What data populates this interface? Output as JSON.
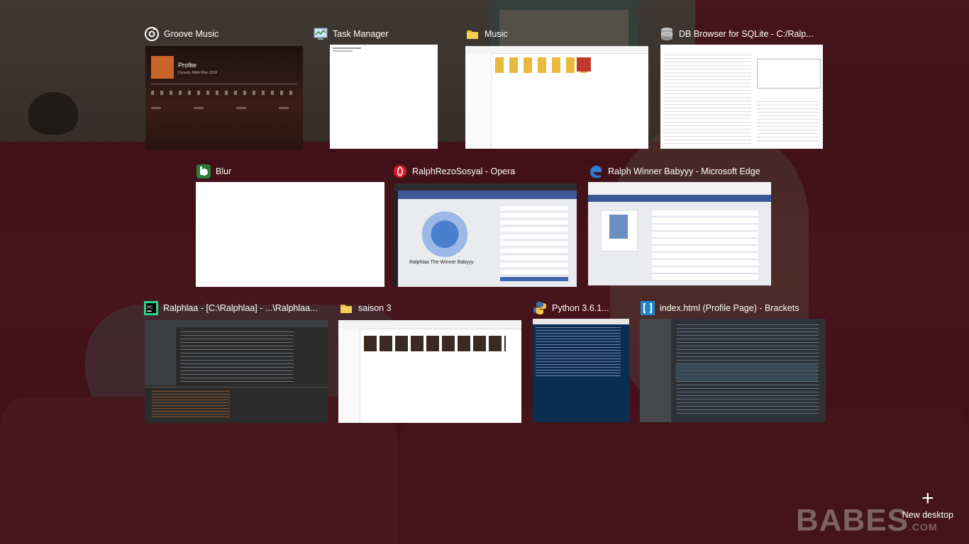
{
  "tasks": [
    {
      "title": "Groove Music",
      "icon": "groove-music-icon"
    },
    {
      "title": "Task Manager",
      "icon": "task-manager-icon"
    },
    {
      "title": "Music",
      "icon": "folder-icon"
    },
    {
      "title": "DB Browser for SQLite - C:/Ralp...",
      "icon": "db-browser-icon"
    },
    {
      "title": "Blur",
      "icon": "blur-app-icon"
    },
    {
      "title": "RalphRezoSosyal - Opera",
      "icon": "opera-icon"
    },
    {
      "title": "Ralph Winner Babyyy - Microsoft Edge",
      "icon": "edge-icon"
    },
    {
      "title": "Ralphlaa - [C:\\Ralphlaa] - ...\\Ralphlaa...",
      "icon": "pycharm-icon"
    },
    {
      "title": "saison 3",
      "icon": "folder-icon"
    },
    {
      "title": "Python 3.6.1...",
      "icon": "python-icon"
    },
    {
      "title": "index.html (Profile Page) - Brackets",
      "icon": "brackets-icon"
    }
  ],
  "groove_thumb": {
    "track": "Profite",
    "artist": "Dynasty Mizik Mais 2016"
  },
  "opera_thumb": {
    "heading": "Ralphlaa The Winner Babyyy"
  },
  "new_desktop": {
    "label": "New desktop"
  },
  "watermark": {
    "text": "BABES",
    "suffix": ".COM"
  },
  "colors": {
    "accent": "#0078d7",
    "overlay": "rgba(0,0,0,0.42)"
  }
}
